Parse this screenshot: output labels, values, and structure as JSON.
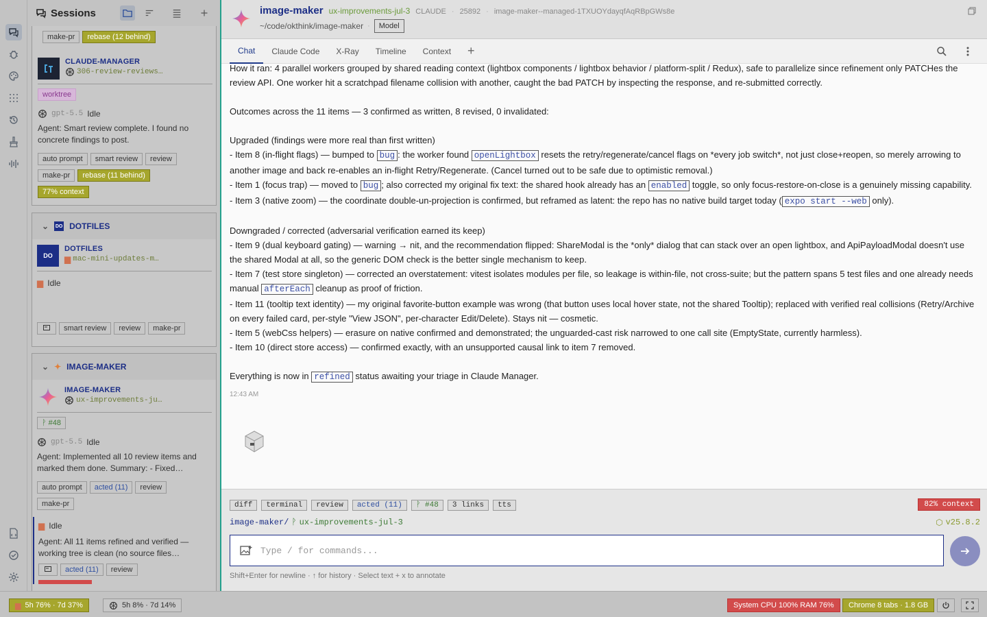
{
  "sessions_panel": {
    "title": "Sessions"
  },
  "top_card": {
    "tags": [
      "make-pr",
      "rebase (12 behind)"
    ]
  },
  "claude_manager": {
    "name": "CLAUDE-MANAGER",
    "branch": "306-review-reviews…",
    "badge": "worktree",
    "model": "gpt-5.5",
    "status": "Idle",
    "agent_text": "Agent: Smart review complete. I found no concrete findings to post.",
    "tags1": [
      "auto prompt",
      "smart review",
      "review"
    ],
    "tags2": [
      "make-pr",
      "rebase (11 behind)"
    ],
    "context": "77% context"
  },
  "dotfiles_section": {
    "short": "DO",
    "title": "DOTFILES",
    "name": "DOTFILES",
    "branch": "mac-mini-updates-m…",
    "status": "Idle",
    "tags": [
      "smart review",
      "review",
      "make-pr"
    ]
  },
  "image_maker_section": {
    "title": "IMAGE-MAKER",
    "name": "IMAGE-MAKER",
    "branch": "ux-improvements-ju…",
    "pr": "#48",
    "model": "gpt-5.5",
    "status": "Idle",
    "agent_text": "Agent: Implemented all 10 review items and marked them done. Summary: - Fixed…",
    "tags1": [
      "auto prompt",
      "acted (11)",
      "review"
    ],
    "tags2": [
      "make-pr"
    ],
    "sub_status": "Idle",
    "sub_agent_text": "Agent: All 11 items refined and verified — working tree is clean (no source files…",
    "sub_tags": [
      "acted (11)",
      "review"
    ]
  },
  "header": {
    "project": "image-maker",
    "branch": "ux-improvements-jul-3",
    "agent": "CLAUDE",
    "pid": "25892",
    "session_id": "image-maker--managed-1TXUOYdayqfAqRBpGWs8e",
    "path": "~/code/okthink/image-maker",
    "model_button": "Model"
  },
  "tabs": [
    "Chat",
    "Claude Code",
    "X-Ray",
    "Timeline",
    "Context"
  ],
  "chat": {
    "line1": "How it ran: 4 parallel workers grouped by shared reading context (lightbox components / lightbox behavior / platform-split / Redux), safe to parallelize since refinement only PATCHes the review API. One worker hit a scratchpad filename collision with another, caught the bad PATCH by inspecting the response, and re-submitted correctly.",
    "line2": "Outcomes across the 11 items — 3 confirmed as written, 8 revised, 0 invalidated:",
    "upgraded_head": "Upgraded (findings were more real than first written)",
    "i8_a": "- Item 8 (in-flight flags) — bumped to ",
    "code_bug": "bug",
    "i8_b": ": the worker found ",
    "code_openlightbox": "openLightbox",
    "i8_c": " resets the retry/regenerate/cancel flags on *every job switch*, not just close+reopen, so merely arrowing to another image and back re-enables an in-flight Retry/Regenerate. (Cancel turned out to be safe due to optimistic removal.)",
    "i1_a": "- Item 1 (focus trap) — moved to ",
    "i1_b": "; also corrected my original fix text: the shared hook already has an ",
    "code_enabled": "enabled",
    "i1_c": " toggle, so only focus-restore-on-close is a genuinely missing capability.",
    "i3_a": "- Item 3 (native zoom) — the coordinate double-un-projection is confirmed, but reframed as latent: the repo has no native build target today (",
    "code_expo": "expo start --web",
    "i3_b": " only).",
    "downgraded_head": "Downgraded / corrected (adversarial verification earned its keep)",
    "i9": "- Item 9 (dual keyboard gating) — warning → nit, and the recommendation flipped: ShareModal is the *only* dialog that can stack over an open lightbox, and ApiPayloadModal doesn't use the shared Modal at all, so the generic DOM check is the better single mechanism to keep.",
    "i7_a": "- Item 7 (test store singleton) — corrected an overstatement: vitest isolates modules per file, so leakage is within-file, not cross-suite; but the pattern spans 5 test files and one already needs manual ",
    "code_aftereach": "afterEach",
    "i7_b": " cleanup as proof of friction.",
    "i11": "- Item 11 (tooltip text identity) — my original favorite-button example was wrong (that button uses local hover state, not the shared Tooltip); replaced with verified real collisions (Retry/Archive on every failed card, per-style \"View JSON\", per-character Edit/Delete). Stays nit — cosmetic.",
    "i5": "- Item 5 (webCss helpers) — erasure on native confirmed and demonstrated; the unguarded-cast risk narrowed to one call site (EmptyState, currently harmless).",
    "i10": "- Item 10 (direct store access) — confirmed exactly, with an unsupported causal link to item 7 removed.",
    "final_a": "Everything is now in ",
    "code_refined": "refined",
    "final_b": " status awaiting your triage in Claude Manager.",
    "timestamp": "12:43 AM"
  },
  "footer": {
    "tags": [
      "diff",
      "terminal",
      "review",
      "acted (11)",
      "#48",
      "3 links",
      "tts"
    ],
    "context": "82% context",
    "path_project": "image-maker/",
    "path_branch": "ux-improvements-jul-3",
    "version": "v25.8.2",
    "input_placeholder": "Type / for commands...",
    "hint": "Shift+Enter for newline · ↑ for history · Select text + x to annotate"
  },
  "statusbar": {
    "claude_usage": "5h 76% · 7d 37%",
    "gpt_usage": "5h 8% · 7d 14%",
    "system": "System CPU 100% RAM 76%",
    "chrome": "Chrome 8 tabs · 1.8 GB"
  }
}
